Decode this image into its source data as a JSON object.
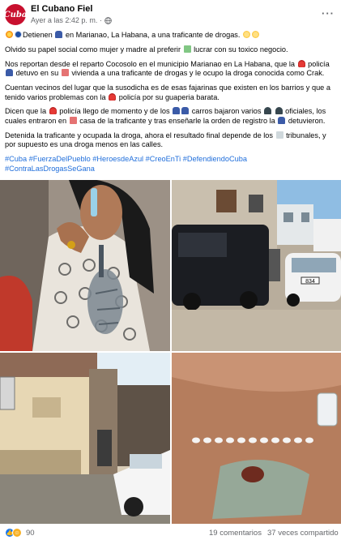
{
  "header": {
    "avatar_text": "Cuba",
    "page_name": "El Cubano Fiel",
    "timestamp": "Ayer a las 2:42 p. m. ·",
    "privacy_icon": "globe-icon",
    "more_label": "···"
  },
  "post": {
    "line1": {
      "pre": "Detienen",
      "mid": "en Marianao, La Habana, a una traficante de drogas."
    },
    "line2": {
      "pre": "Olvido su papel social como mujer y madre al preferir",
      "post": "lucrar con su toxico negocio."
    },
    "para3": {
      "a": "Nos reportan desde el reparto Cocosolo en el municipio Marianao en La Habana, que la",
      "b": "policía",
      "c": "detuvo en su",
      "d": "vivienda a una traficante de drogas y le ocupo la droga conocida como Crak."
    },
    "para4": {
      "a": "Cuentan vecinos del lugar que la susodicha es de esas fajarinas que existen en los barrios y que a tenido varios problemas con la",
      "b": "policía por su guaperia barata."
    },
    "para5": {
      "a": "Dicen que la",
      "b": "policía llego de momento y de los",
      "c": "carros bajaron varios",
      "d": "oficiales, los cuales entraron en",
      "e": "casa de la traficante y tras enseñarle la orden de registro la",
      "f": "detuvieron."
    },
    "para6": {
      "a": "Detenida la traficante y ocupada la droga, ahora el resultado final depende de los",
      "b": "tribunales, y por supuesto es una droga menos en las calles."
    },
    "hashtags_line1": "#Cuba #FuerzaDelPueblo #HeroesdeAzul #CreoEnTi #DefendiendoCuba",
    "hashtags_line2": "#ContraLasDrogasSeGana"
  },
  "photos": [
    {
      "subject": "woman-holding-bag"
    },
    {
      "subject": "police-cars-on-street",
      "car_number": "834"
    },
    {
      "subject": "narrow-street-with-car"
    },
    {
      "subject": "drug-packets-on-floor"
    }
  ],
  "footer": {
    "reaction_icons": [
      "like-icon",
      "care-icon"
    ],
    "reaction_count": "90",
    "comments": "19 comentarios",
    "shares": "37 veces compartido"
  }
}
